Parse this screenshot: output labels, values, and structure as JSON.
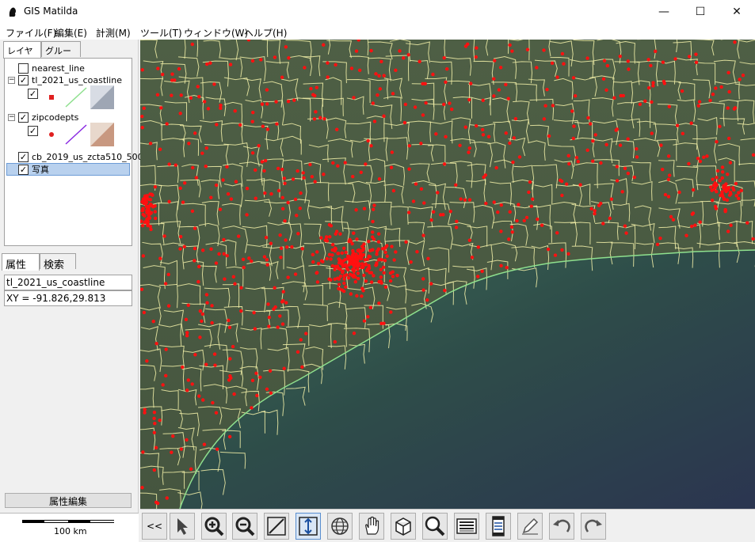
{
  "window": {
    "title": "GIS Matilda"
  },
  "menu": [
    "ファイル(F)",
    "編集(E)",
    "計測(M)",
    "ツール(T)",
    "ウィンドウ(W)",
    "ヘルプ(H)"
  ],
  "layer_tabs": [
    "レイヤー",
    "グループ"
  ],
  "layers": [
    {
      "name": "nearest_line",
      "checked": false
    },
    {
      "name": "tl_2021_us_coastline",
      "checked": true
    },
    {
      "name": "zipcodepts",
      "checked": true
    },
    {
      "name": "cb_2019_us_zcta510_500",
      "checked": true
    },
    {
      "name": "写真",
      "checked": true,
      "selected": true
    }
  ],
  "attr_tabs": [
    "属性",
    "検索"
  ],
  "attributes": {
    "layer": "tl_2021_us_coastline",
    "xy": "XY = -91.826,29.813"
  },
  "edit_button": "属性編集",
  "scale_label": "100 km",
  "toolbar": {
    "back": "<<"
  },
  "icons": [
    "pointer-icon",
    "zoom-in-icon",
    "zoom-out-icon",
    "line-measure-icon",
    "vertical-measure-icon",
    "globe-icon",
    "pan-hand-icon",
    "cube-icon",
    "search-icon",
    "list-icon",
    "column-icon",
    "edit-pen-icon",
    "undo-icon",
    "redo-icon"
  ],
  "colors": {
    "points": "#ff1010",
    "boundaries": "#f2f0a8",
    "coastline": "#8ee08e",
    "selection": "#b9d1ee"
  }
}
